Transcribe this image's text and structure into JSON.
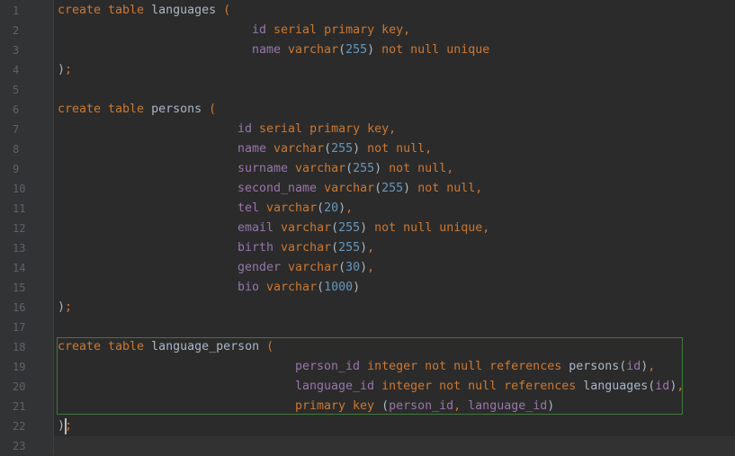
{
  "editor": {
    "line_numbers": [
      "1",
      "2",
      "3",
      "4",
      "5",
      "6",
      "7",
      "8",
      "9",
      "10",
      "11",
      "12",
      "13",
      "14",
      "15",
      "16",
      "17",
      "18",
      "19",
      "20",
      "21",
      "22",
      "23"
    ],
    "lines": [
      {
        "indent": 0,
        "tokens": [
          [
            "k",
            "create table "
          ],
          [
            "t",
            "languages "
          ],
          [
            "k",
            "("
          ]
        ]
      },
      {
        "indent": 216,
        "tokens": [
          [
            "i",
            "id "
          ],
          [
            "k",
            "serial primary key,"
          ]
        ]
      },
      {
        "indent": 216,
        "tokens": [
          [
            "i",
            "name "
          ],
          [
            "k",
            "varchar"
          ],
          [
            "t",
            "("
          ],
          [
            "n",
            "255"
          ],
          [
            "t",
            ") "
          ],
          [
            "k",
            "not null unique"
          ]
        ]
      },
      {
        "indent": 0,
        "tokens": [
          [
            "t",
            ")"
          ],
          [
            "k",
            ";"
          ]
        ]
      },
      {
        "indent": 0,
        "tokens": []
      },
      {
        "indent": 0,
        "tokens": [
          [
            "k",
            "create table "
          ],
          [
            "t",
            "persons "
          ],
          [
            "k",
            "("
          ]
        ]
      },
      {
        "indent": 200,
        "tokens": [
          [
            "i",
            "id "
          ],
          [
            "k",
            "serial primary key,"
          ]
        ]
      },
      {
        "indent": 200,
        "tokens": [
          [
            "i",
            "name "
          ],
          [
            "k",
            "varchar"
          ],
          [
            "t",
            "("
          ],
          [
            "n",
            "255"
          ],
          [
            "t",
            ") "
          ],
          [
            "k",
            "not null,"
          ]
        ]
      },
      {
        "indent": 200,
        "tokens": [
          [
            "i",
            "surname "
          ],
          [
            "k",
            "varchar"
          ],
          [
            "t",
            "("
          ],
          [
            "n",
            "255"
          ],
          [
            "t",
            ") "
          ],
          [
            "k",
            "not null,"
          ]
        ]
      },
      {
        "indent": 200,
        "tokens": [
          [
            "i",
            "second_name "
          ],
          [
            "k",
            "varchar"
          ],
          [
            "t",
            "("
          ],
          [
            "n",
            "255"
          ],
          [
            "t",
            ") "
          ],
          [
            "k",
            "not null,"
          ]
        ]
      },
      {
        "indent": 200,
        "tokens": [
          [
            "i",
            "tel "
          ],
          [
            "k",
            "varchar"
          ],
          [
            "t",
            "("
          ],
          [
            "n",
            "20"
          ],
          [
            "t",
            ")"
          ],
          [
            "k",
            ","
          ]
        ]
      },
      {
        "indent": 200,
        "tokens": [
          [
            "i",
            "email "
          ],
          [
            "k",
            "varchar"
          ],
          [
            "t",
            "("
          ],
          [
            "n",
            "255"
          ],
          [
            "t",
            ") "
          ],
          [
            "k",
            "not null unique,"
          ]
        ]
      },
      {
        "indent": 200,
        "tokens": [
          [
            "i",
            "birth "
          ],
          [
            "k",
            "varchar"
          ],
          [
            "t",
            "("
          ],
          [
            "n",
            "255"
          ],
          [
            "t",
            ")"
          ],
          [
            "k",
            ","
          ]
        ]
      },
      {
        "indent": 200,
        "tokens": [
          [
            "i",
            "gender "
          ],
          [
            "k",
            "varchar"
          ],
          [
            "t",
            "("
          ],
          [
            "n",
            "30"
          ],
          [
            "t",
            ")"
          ],
          [
            "k",
            ","
          ]
        ]
      },
      {
        "indent": 200,
        "tokens": [
          [
            "i",
            "bio "
          ],
          [
            "k",
            "varchar"
          ],
          [
            "t",
            "("
          ],
          [
            "n",
            "1000"
          ],
          [
            "t",
            ")"
          ]
        ]
      },
      {
        "indent": 0,
        "tokens": [
          [
            "t",
            ")"
          ],
          [
            "k",
            ";"
          ]
        ]
      },
      {
        "indent": 0,
        "tokens": []
      },
      {
        "indent": 0,
        "tokens": [
          [
            "k",
            "create table "
          ],
          [
            "t",
            "language_person "
          ],
          [
            "k",
            "("
          ]
        ]
      },
      {
        "indent": 264,
        "tokens": [
          [
            "i",
            "person_id "
          ],
          [
            "k",
            "integer not null references "
          ],
          [
            "t",
            "persons("
          ],
          [
            "i",
            "id"
          ],
          [
            "t",
            ")"
          ],
          [
            "k",
            ","
          ]
        ]
      },
      {
        "indent": 264,
        "tokens": [
          [
            "i",
            "language_id "
          ],
          [
            "k",
            "integer not null references "
          ],
          [
            "t",
            "languages("
          ],
          [
            "i",
            "id"
          ],
          [
            "t",
            ")"
          ],
          [
            "k",
            ","
          ]
        ]
      },
      {
        "indent": 264,
        "tokens": [
          [
            "k",
            "primary key "
          ],
          [
            "t",
            "("
          ],
          [
            "i",
            "person_id"
          ],
          [
            "k",
            ", "
          ],
          [
            "i",
            "language_id"
          ],
          [
            "t",
            ")"
          ]
        ]
      },
      {
        "indent": 0,
        "tokens": [
          [
            "t",
            ")"
          ],
          [
            "k",
            ";"
          ]
        ]
      },
      {
        "indent": 0,
        "tokens": []
      }
    ],
    "current_line": 23,
    "colors": {
      "background": "#2b2b2b",
      "gutter": "#313335",
      "keyword": "#cc7832",
      "identifier": "#9876aa",
      "number": "#6897bb",
      "selection_border": "#3f7a3a"
    }
  }
}
